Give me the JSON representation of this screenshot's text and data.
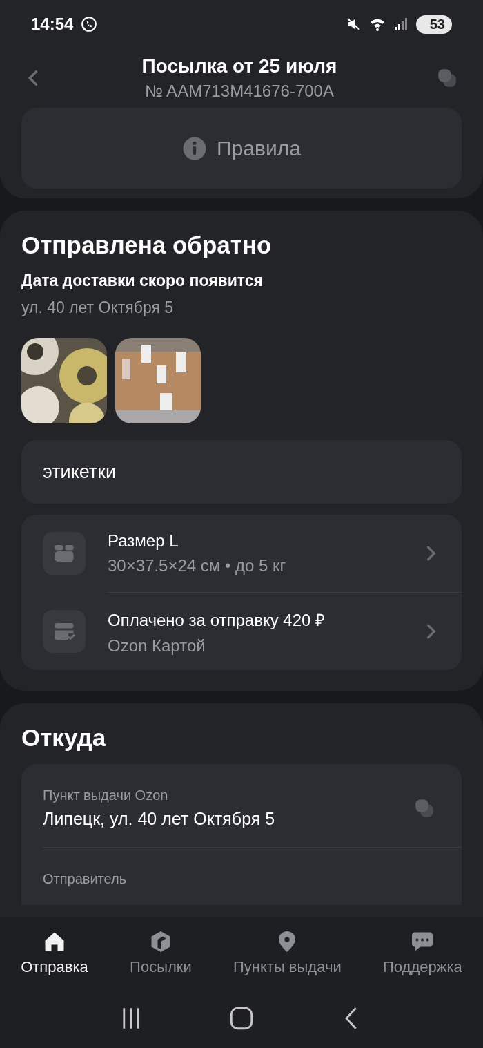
{
  "status_bar": {
    "time": "14:54",
    "battery": "53"
  },
  "header": {
    "title": "Посылка от 25 июля",
    "subtitle": "№ AAM713M41676-700A"
  },
  "rules_button": {
    "label": "Правила"
  },
  "status_card": {
    "title": "Отправлена обратно",
    "delivery": "Дата доставки скоро появится",
    "address": "ул. 40 лет Октября 5",
    "comment": "этикетки",
    "details": [
      {
        "kind": "box",
        "title": "Размер L",
        "subtitle": "30×37.5×24 см • до 5 кг"
      },
      {
        "kind": "card",
        "title": "Оплачено за отправку 420 ₽",
        "subtitle": "Ozon Картой"
      }
    ]
  },
  "from": {
    "title": "Откуда",
    "rows": [
      {
        "kind": "copy",
        "label": "Пункт выдачи Ozon",
        "value": "Липецк, ул. 40 лет Октября 5"
      },
      {
        "kind": "plain",
        "label": "Отправитель"
      }
    ]
  },
  "nav": [
    {
      "kind": "home",
      "label": "Отправка",
      "selected": true
    },
    {
      "kind": "parcel",
      "label": "Посылки",
      "selected": false
    },
    {
      "kind": "pin",
      "label": "Пункты выдачи",
      "selected": false
    },
    {
      "kind": "chat",
      "label": "Поддержка",
      "selected": false
    }
  ]
}
